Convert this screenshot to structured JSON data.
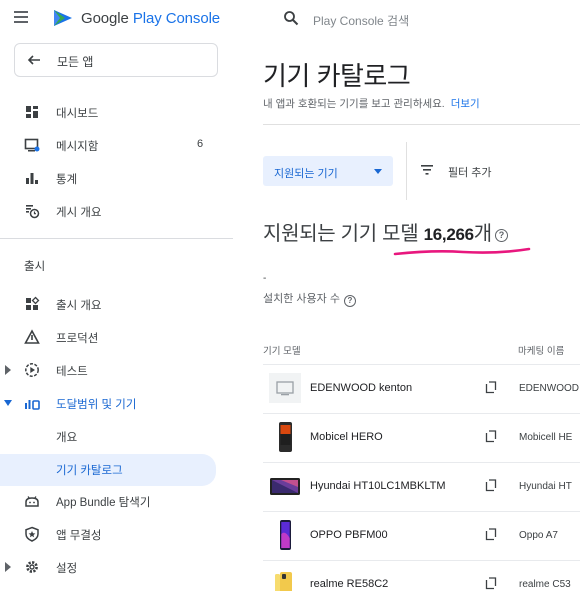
{
  "app": {
    "brand_google": "Google",
    "brand_play": "Play Console"
  },
  "sidebar": {
    "all_apps": "모든 앱",
    "items": [
      {
        "label": "대시보드"
      },
      {
        "label": "메시지함",
        "count": "6"
      },
      {
        "label": "통계"
      },
      {
        "label": "게시 개요"
      }
    ],
    "section_label": "출시",
    "release_items": [
      {
        "label": "출시 개요"
      },
      {
        "label": "프로덕션"
      },
      {
        "label": "테스트"
      },
      {
        "label": "도달범위 및 기기"
      },
      {
        "label": "개요"
      },
      {
        "label": "기기 카탈로그"
      },
      {
        "label": "App Bundle 탐색기"
      },
      {
        "label": "앱 무결성"
      },
      {
        "label": "설정"
      }
    ]
  },
  "search": {
    "placeholder": "Play Console 검색"
  },
  "page": {
    "title": "기기 카탈로그",
    "description": "내 앱과 호환되는 기기를 보고 관리하세요.",
    "learn_more": "더보기"
  },
  "filters": {
    "supported": "지원되는 기기",
    "add_filter": "필터 추가"
  },
  "summary": {
    "prefix": "지원되는 기기 모델",
    "count": "16,266",
    "suffix": "개",
    "dash": "-",
    "installed_label": "설치한 사용자 수"
  },
  "table": {
    "col_model": "기기 모델",
    "col_marketing": "마케팅 이름",
    "rows": [
      {
        "model": "EDENWOOD kenton",
        "marketing": "EDENWOOD"
      },
      {
        "model": "Mobicel HERO",
        "marketing": "Mobicell HE"
      },
      {
        "model": "Hyundai HT10LC1MBKLTM",
        "marketing": "Hyundai HT"
      },
      {
        "model": "OPPO PBFM00",
        "marketing": "Oppo A7"
      },
      {
        "model": "realme RE58C2",
        "marketing": "realme C53"
      }
    ]
  },
  "colors": {
    "accent": "#1a73e8",
    "active_bg": "#e8f0fe",
    "highlight_underline": "#e8177e"
  }
}
